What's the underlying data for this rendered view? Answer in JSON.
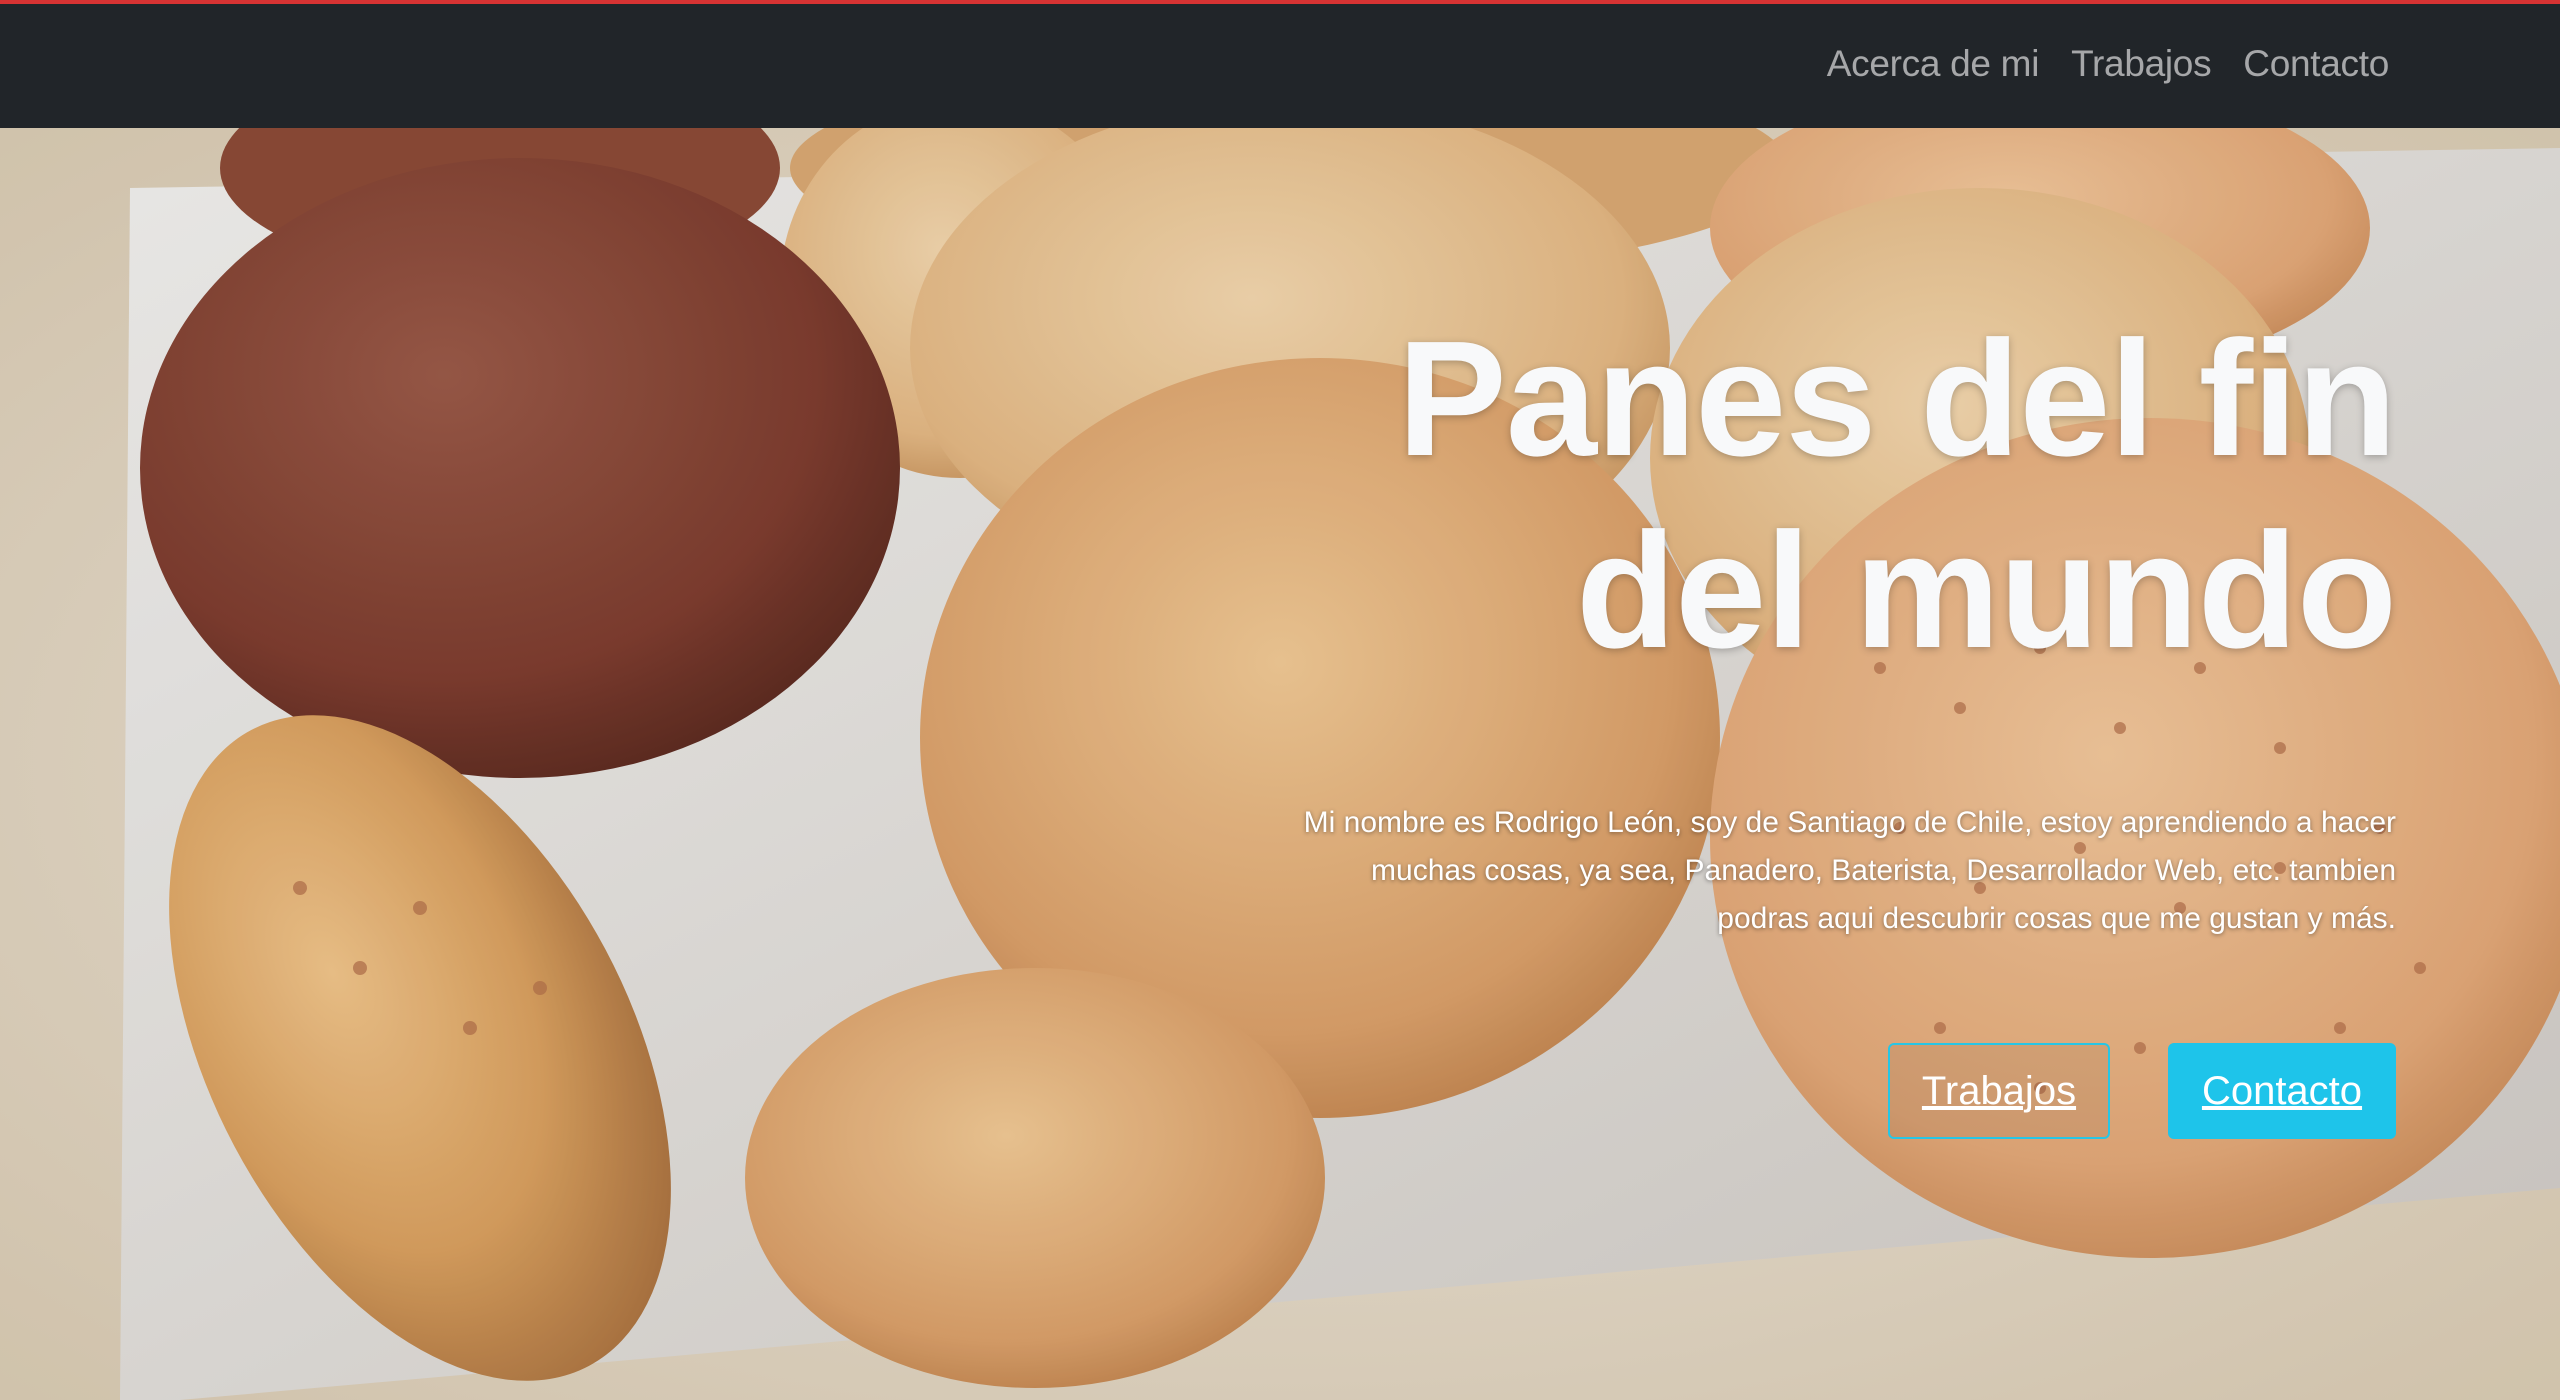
{
  "nav": {
    "links": [
      "Acerca de mi",
      "Trabajos",
      "Contacto"
    ]
  },
  "hero": {
    "title_line1": "Panes del fin",
    "title_line2": "del mundo",
    "lead": "Mi nombre es Rodrigo León, soy de Santiago de Chile, estoy aprendiendo a hacer muchas cosas, ya sea, Panadero, Baterista, Desarrollador Web, etc. tambien podras aqui descubrir cosas que me gustan y más.",
    "buttons": {
      "outline_label": "Trabajos",
      "primary_label": "Contacto"
    }
  },
  "colors": {
    "navbar": "#212529",
    "accent": "#1ec4ea",
    "top_line": "#d63333"
  }
}
